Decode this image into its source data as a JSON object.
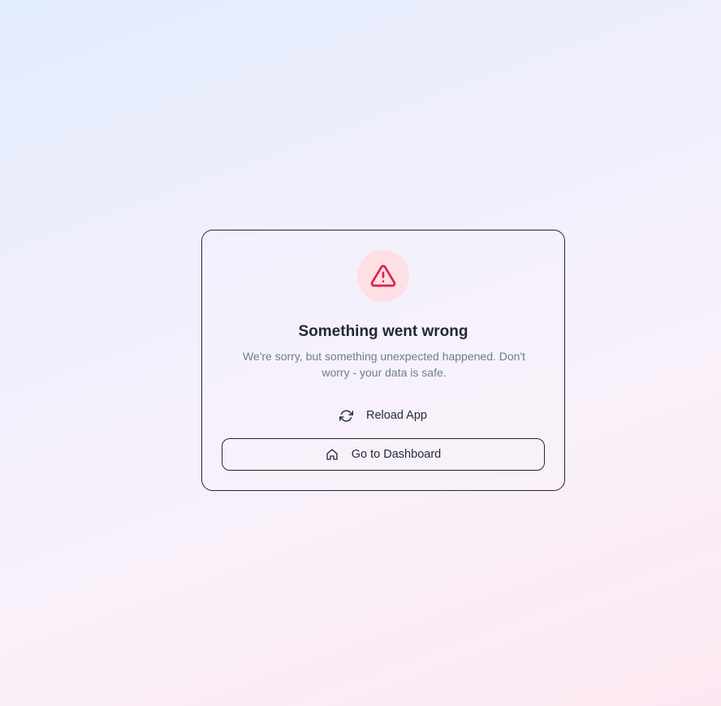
{
  "error": {
    "title": "Something went wrong",
    "message": "We're sorry, but something unexpected happened. Don't worry - your data is safe.",
    "icon": "alert-triangle-icon"
  },
  "actions": {
    "reload_label": "Reload App",
    "reload_icon": "refresh-icon",
    "dashboard_label": "Go to Dashboard",
    "dashboard_icon": "home-icon"
  },
  "colors": {
    "danger": "#e11d48",
    "danger_bg": "#fde0e4",
    "text_primary": "#1f2937",
    "text_muted": "#6b7f8e"
  }
}
